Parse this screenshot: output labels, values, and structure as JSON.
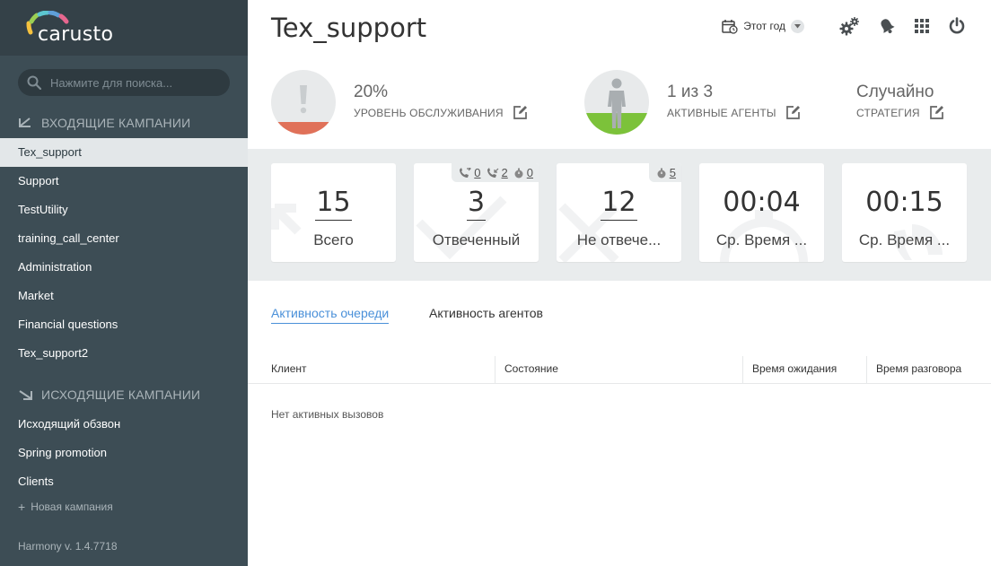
{
  "brand": {
    "logo_text": "carusto"
  },
  "search": {
    "placeholder": "Нажмите для поиска..."
  },
  "sidebar": {
    "incoming_header": "ВХОДЯЩИЕ КАМПАНИИ",
    "incoming": [
      {
        "label": "Tex_support",
        "active": true
      },
      {
        "label": "Support"
      },
      {
        "label": "TestUtility"
      },
      {
        "label": "training_call_center"
      },
      {
        "label": "Administration"
      },
      {
        "label": "Market"
      },
      {
        "label": "Financial questions"
      },
      {
        "label": "Tex_support2"
      }
    ],
    "outgoing_header": "ИСХОДЯЩИЕ КАМПАНИИ",
    "outgoing": [
      {
        "label": "Исходящий обзвон"
      },
      {
        "label": "Spring promotion"
      },
      {
        "label": "Clients"
      }
    ],
    "new_campaign": "Новая кампания",
    "version": "Harmony v. 1.4.7718"
  },
  "header": {
    "title": "Tex_support",
    "period": "Этот год",
    "icons": [
      "calendar-icon",
      "gears-icon",
      "bell-icon",
      "apps-grid-icon",
      "power-icon"
    ]
  },
  "kpis": {
    "service_level": {
      "value": "20%",
      "label": "УРОВЕНЬ ОБСЛУЖИВАНИЯ",
      "fill_fraction": 0.2,
      "color": "#e07159"
    },
    "agents": {
      "value": "1 из 3",
      "label": "АКТИВНЫЕ АГЕНТЫ",
      "fill_fraction": 0.33,
      "color": "#7cc23a"
    },
    "strategy": {
      "value": "Случайно",
      "label": "СТРАТЕГИЯ"
    }
  },
  "stats": [
    {
      "value": "15",
      "label": "Всего",
      "underlined": true
    },
    {
      "value": "3",
      "label": "Отвеченный",
      "underlined": true,
      "badges": [
        "0",
        "2",
        "0"
      ]
    },
    {
      "value": "12",
      "label": "Не отвече...",
      "underlined": true,
      "badges": [
        "5"
      ]
    },
    {
      "value": "00:04",
      "label": "Ср. Время ...",
      "underlined": false
    },
    {
      "value": "00:15",
      "label": "Ср. Время ...",
      "underlined": false
    }
  ],
  "tabs": [
    {
      "label": "Активность очереди",
      "active": true
    },
    {
      "label": "Активность агентов"
    }
  ],
  "table": {
    "columns": [
      "Клиент",
      "Состояние",
      "Время ожидания",
      "Время разговора"
    ],
    "empty_text": "Нет активных вызовов"
  },
  "colors": {
    "sidebar": "#3d4d55",
    "accent": "#4a90d9",
    "stats_band": "#e9eced"
  }
}
